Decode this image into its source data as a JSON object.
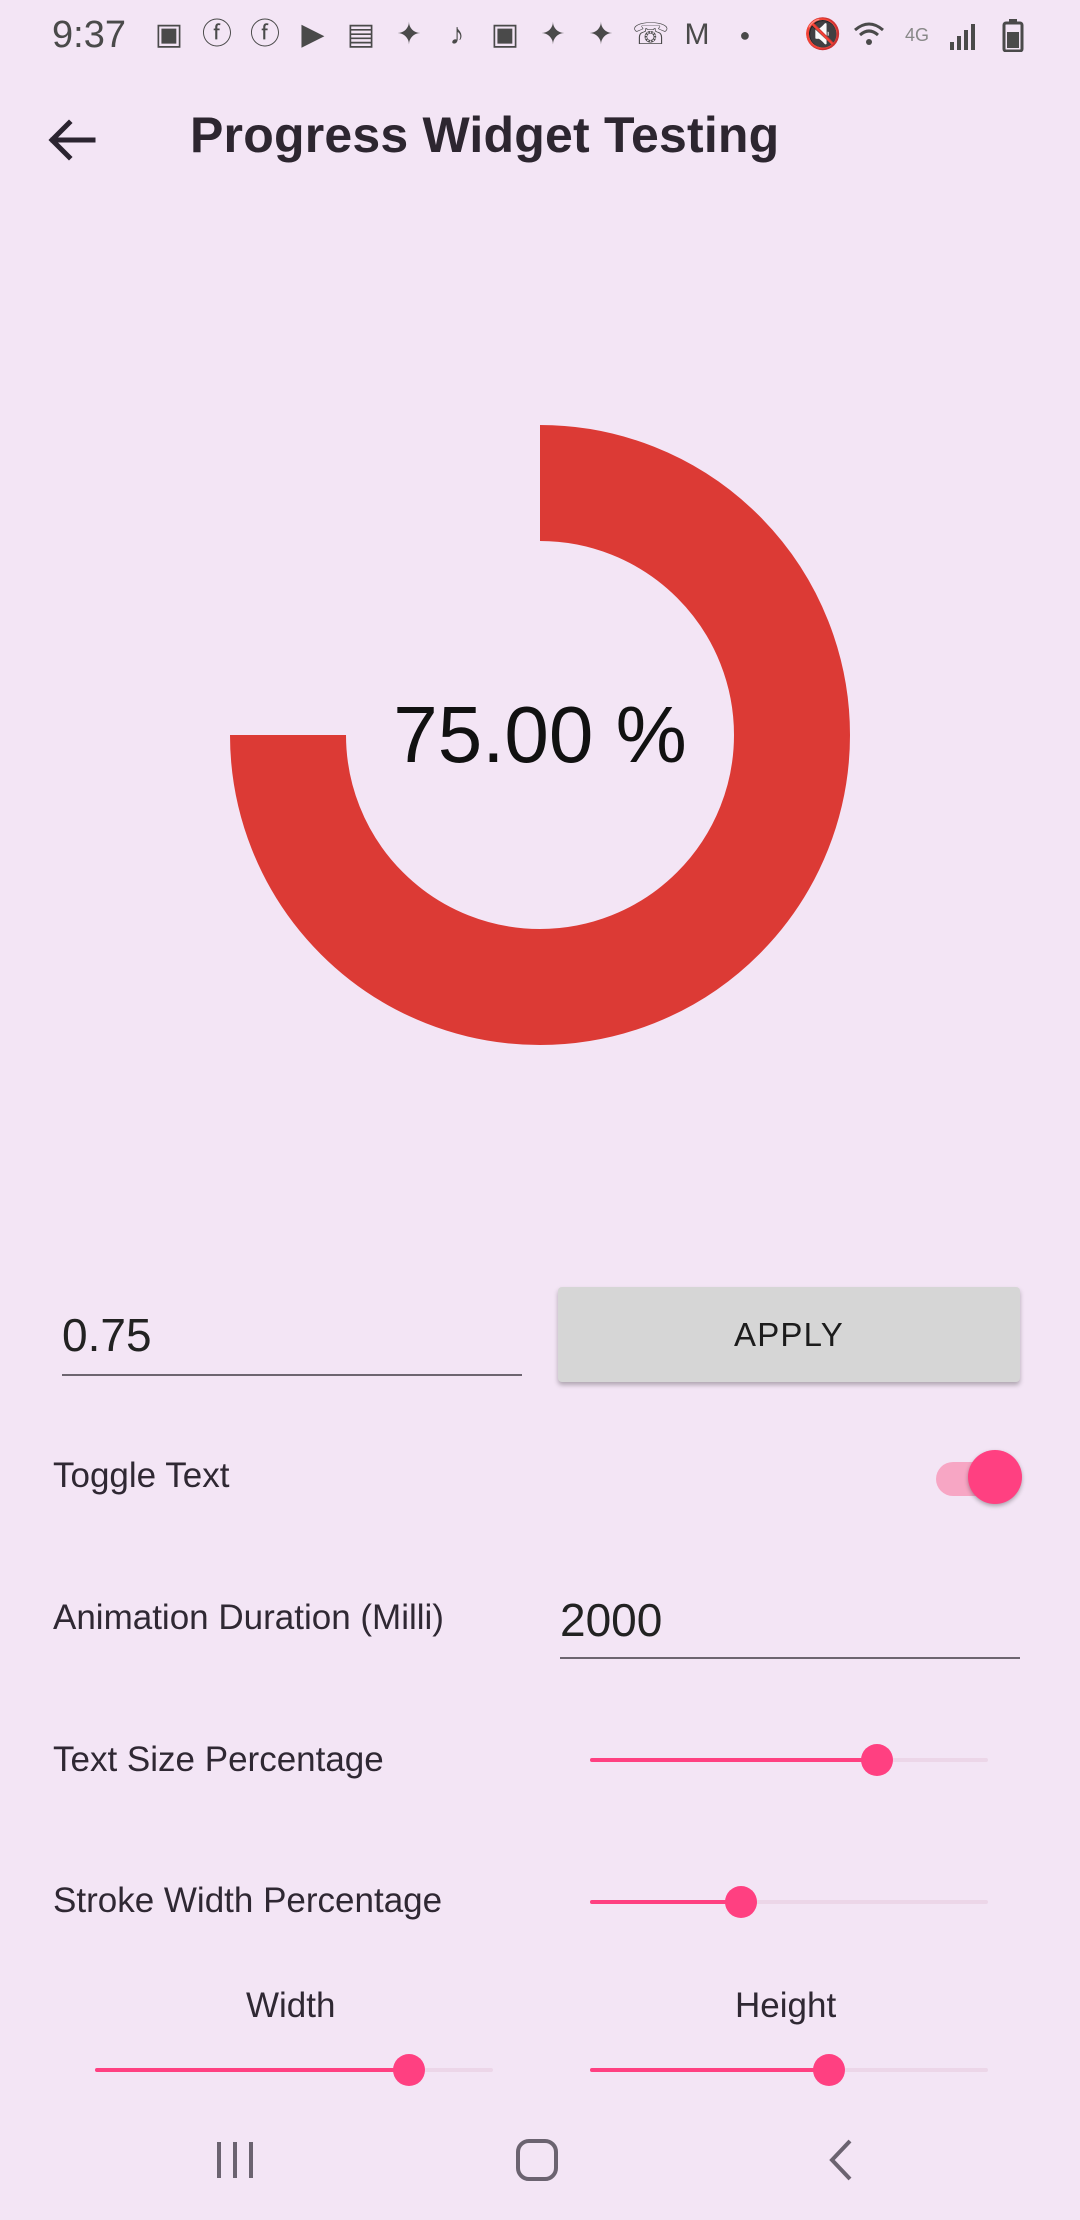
{
  "status_bar": {
    "time": "9:37",
    "left_icons": [
      "video-camera-icon",
      "facebook-icon",
      "facebook-icon",
      "youtube-icon",
      "news-icon",
      "twitter-icon",
      "bell-icon",
      "video-camera-icon",
      "twitter-icon",
      "twitter-icon",
      "wifi-call-icon",
      "gmail-icon",
      "dot-icon"
    ],
    "right_icons": [
      "mute-icon",
      "wifi-icon",
      "lte-icon",
      "signal-icon",
      "battery-icon"
    ]
  },
  "app_bar": {
    "title": "Progress Widget Testing"
  },
  "progress": {
    "value": 0.75,
    "text": "75.00 %",
    "color": "#DC3A35"
  },
  "controls": {
    "progress_input_value": "0.75",
    "apply_label": "APPLY",
    "toggle_text_label": "Toggle Text",
    "toggle_text_on": true,
    "duration_label": "Animation Duration (Milli)",
    "duration_value": "2000",
    "text_size_label": "Text Size Percentage",
    "text_size_value": 0.72,
    "stroke_width_label": "Stroke Width Percentage",
    "stroke_width_value": 0.38,
    "width_label": "Width",
    "width_value": 0.79,
    "height_label": "Height",
    "height_value": 0.6
  },
  "colors": {
    "background": "#F3E5F5",
    "accent": "#FF4081",
    "button": "#D6D6D6"
  }
}
